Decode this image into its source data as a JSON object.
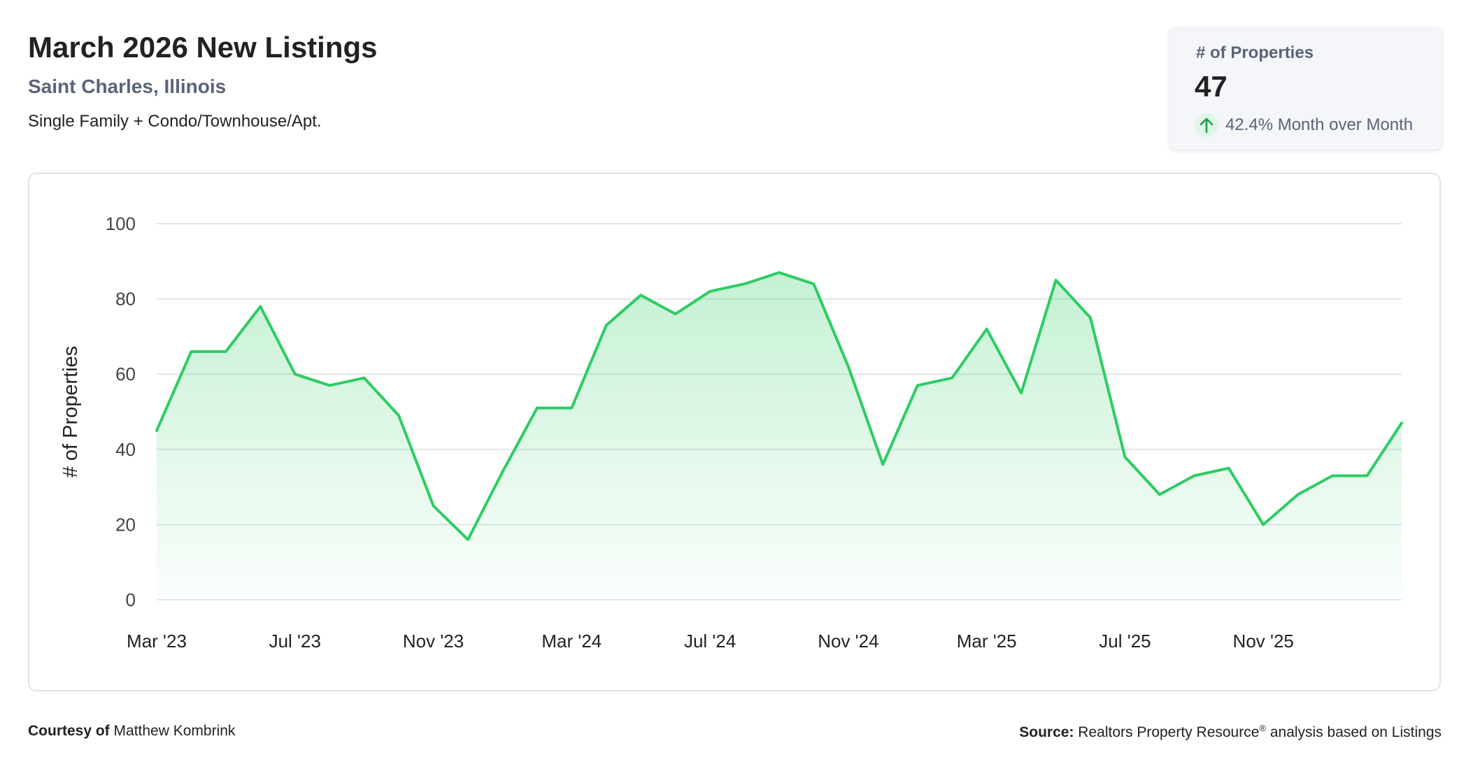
{
  "header": {
    "title": "March 2026 New Listings",
    "location": "Saint Charles, Illinois",
    "property_types": "Single Family + Condo/Townhouse/Apt."
  },
  "kpi": {
    "label": "# of Properties",
    "value": "47",
    "change_text": "42.4% Month over Month",
    "direction_icon": "arrow-up-icon"
  },
  "colors": {
    "line": "#2ecc63",
    "fill": "#2ecc63",
    "grid": "#e2e6ea",
    "axis_text": "#444444"
  },
  "chart_data": {
    "type": "area",
    "ylabel": "# of Properties",
    "xlabel": "",
    "ylim": [
      0,
      100
    ],
    "yticks": [
      0,
      20,
      40,
      60,
      80,
      100
    ],
    "grid": true,
    "x": [
      "Mar '23",
      "Apr '23",
      "May '23",
      "Jun '23",
      "Jul '23",
      "Aug '23",
      "Sep '23",
      "Oct '23",
      "Nov '23",
      "Dec '23",
      "Jan '24",
      "Feb '24",
      "Mar '24",
      "Apr '24",
      "May '24",
      "Jun '24",
      "Jul '24",
      "Aug '24",
      "Sep '24",
      "Oct '24",
      "Nov '24",
      "Dec '24",
      "Jan '25",
      "Feb '25",
      "Mar '25",
      "Apr '25",
      "May '25",
      "Jun '25",
      "Jul '25",
      "Aug '25",
      "Sep '25",
      "Oct '25",
      "Nov '25",
      "Dec '25",
      "Jan '26",
      "Feb '26",
      "Mar '26"
    ],
    "x_tick_labels": [
      "Mar '23",
      "Jul '23",
      "Nov '23",
      "Mar '24",
      "Jul '24",
      "Nov '24",
      "Mar '25",
      "Jul '25",
      "Nov '25"
    ],
    "series": [
      {
        "values": [
          45,
          66,
          66,
          78,
          60,
          57,
          59,
          49,
          25,
          16,
          34,
          51,
          51,
          73,
          81,
          76,
          82,
          84,
          87,
          84,
          62,
          36,
          57,
          59,
          72,
          55,
          85,
          75,
          38,
          28,
          33,
          35,
          20,
          28,
          33,
          33,
          47
        ]
      }
    ]
  },
  "footer": {
    "courtesy_label": "Courtesy of",
    "courtesy_name": "Matthew Kombrink",
    "source_label": "Source:",
    "source_name": "Realtors Property Resource",
    "source_mark": "®",
    "source_suffix": "analysis based on Listings"
  }
}
